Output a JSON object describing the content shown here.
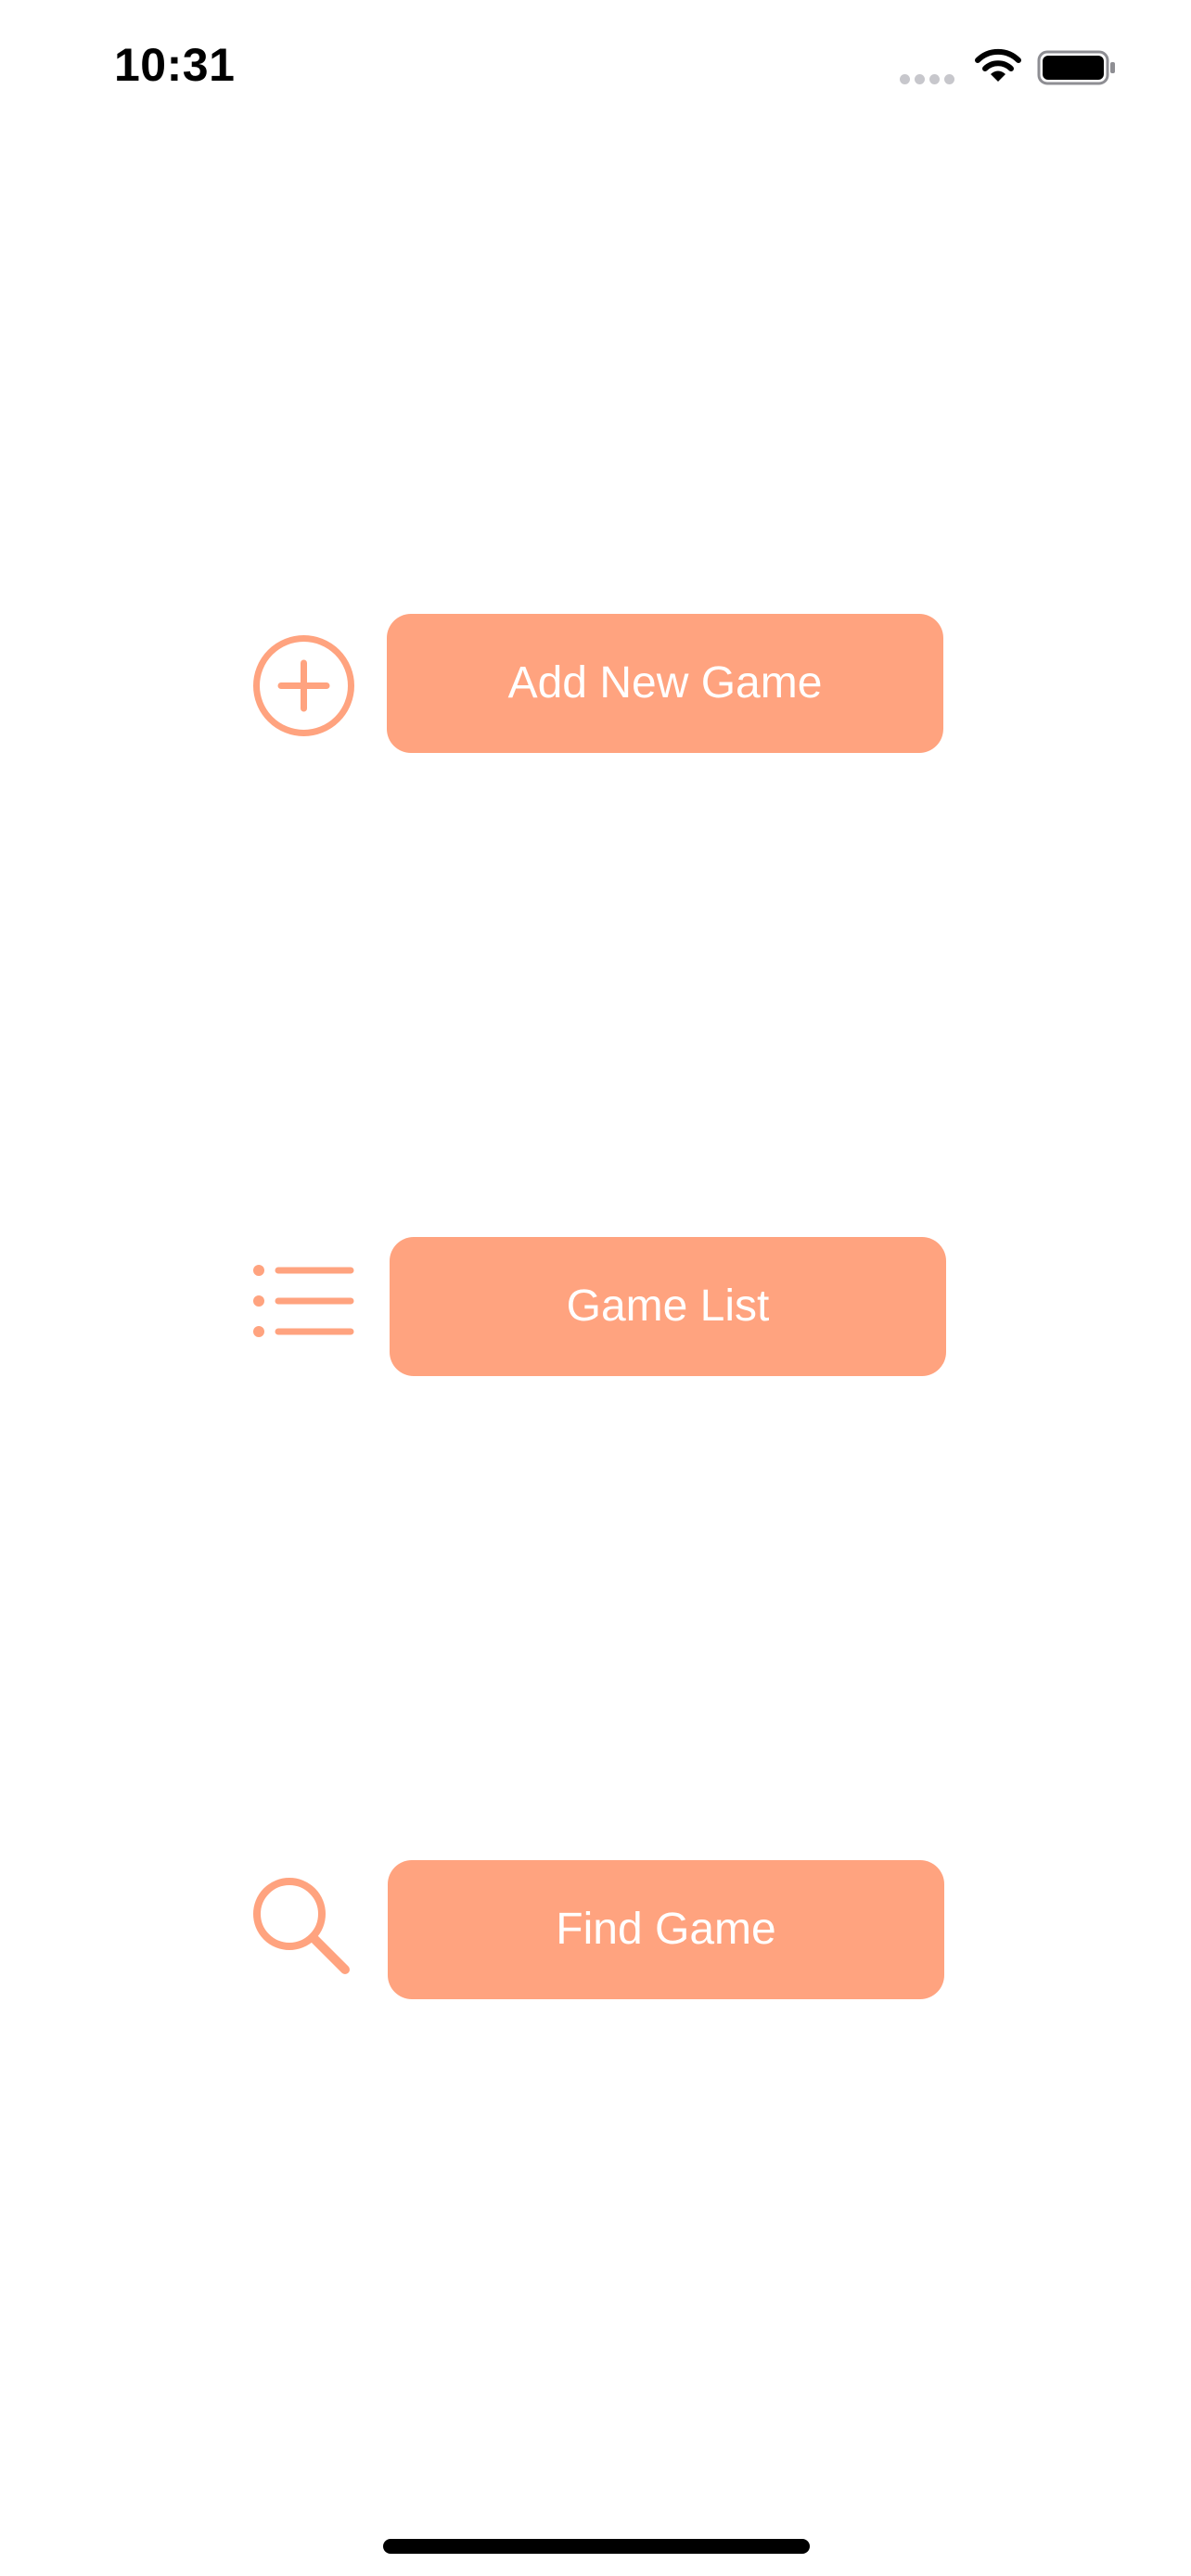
{
  "status_bar": {
    "time": "10:31",
    "icons": [
      "cellular-signal-icon",
      "wifi-icon",
      "battery-icon"
    ]
  },
  "menu": {
    "add_new_game": {
      "label": "Add New Game",
      "icon": "plus-circle-icon"
    },
    "game_list": {
      "label": "Game List",
      "icon": "list-bullet-icon"
    },
    "find_game": {
      "label": "Find Game",
      "icon": "magnifying-glass-icon"
    }
  },
  "colors": {
    "accent": "#ffa37f",
    "button_text": "#ffffff",
    "background": "#ffffff"
  }
}
